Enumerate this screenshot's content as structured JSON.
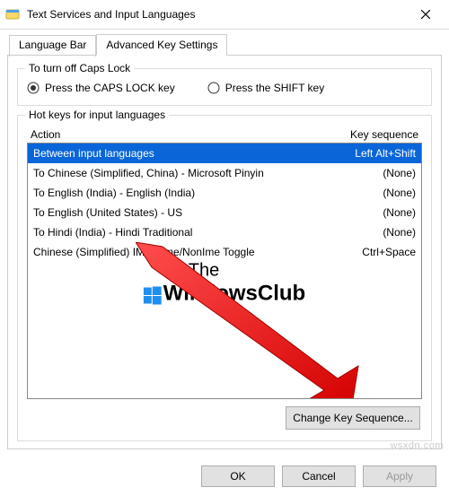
{
  "window": {
    "title": "Text Services and Input Languages"
  },
  "tabs": {
    "language_bar": "Language Bar",
    "advanced_key": "Advanced Key Settings"
  },
  "caps_group": {
    "title": "To turn off Caps Lock",
    "opt1": "Press the CAPS LOCK key",
    "opt2": "Press the SHIFT key"
  },
  "hotkeys_group": {
    "title": "Hot keys for input languages",
    "col_action": "Action",
    "col_key": "Key sequence",
    "rows": [
      {
        "action": "Between input languages",
        "key": "Left Alt+Shift"
      },
      {
        "action": "To Chinese (Simplified, China) - Microsoft Pinyin",
        "key": "(None)"
      },
      {
        "action": "To English (India) - English (India)",
        "key": "(None)"
      },
      {
        "action": "To English (United States) - US",
        "key": "(None)"
      },
      {
        "action": "To Hindi (India) - Hindi Traditional",
        "key": "(None)"
      },
      {
        "action": "Chinese (Simplified) IME - Ime/NonIme Toggle",
        "key": "Ctrl+Space"
      }
    ],
    "change_btn": "Change Key Sequence..."
  },
  "footer": {
    "ok": "OK",
    "cancel": "Cancel",
    "apply": "Apply"
  },
  "watermark": {
    "line1": "The",
    "line2": "WindowsClub"
  },
  "site": "wsxdn.com"
}
